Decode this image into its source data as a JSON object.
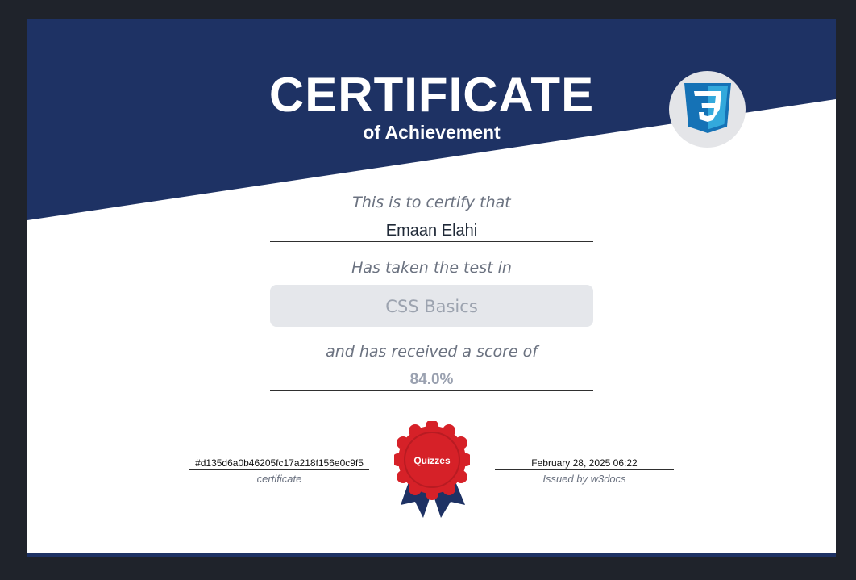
{
  "certificate": {
    "title": "CERTIFICATE",
    "subtitle": "of Achievement",
    "intro": "This is to certify that",
    "recipient": "Emaan Elahi",
    "taken_text": "Has taken the test in",
    "course": "CSS Basics",
    "score_intro": "and has received a score of",
    "score": "84.0%",
    "hash": "#d135d6a0b46205fc17a218f156e0c9f5",
    "hash_label": "certificate",
    "date": "February 28, 2025 06:22",
    "issuer": "Issued by w3docs",
    "badge_text": "Quizzes",
    "logo_icon": "css3-icon"
  },
  "colors": {
    "background": "#1f232b",
    "banner": "#1e3264",
    "badge_red": "#d62128",
    "course_box": "#e5e7eb",
    "css3_blue": "#1572b6"
  }
}
